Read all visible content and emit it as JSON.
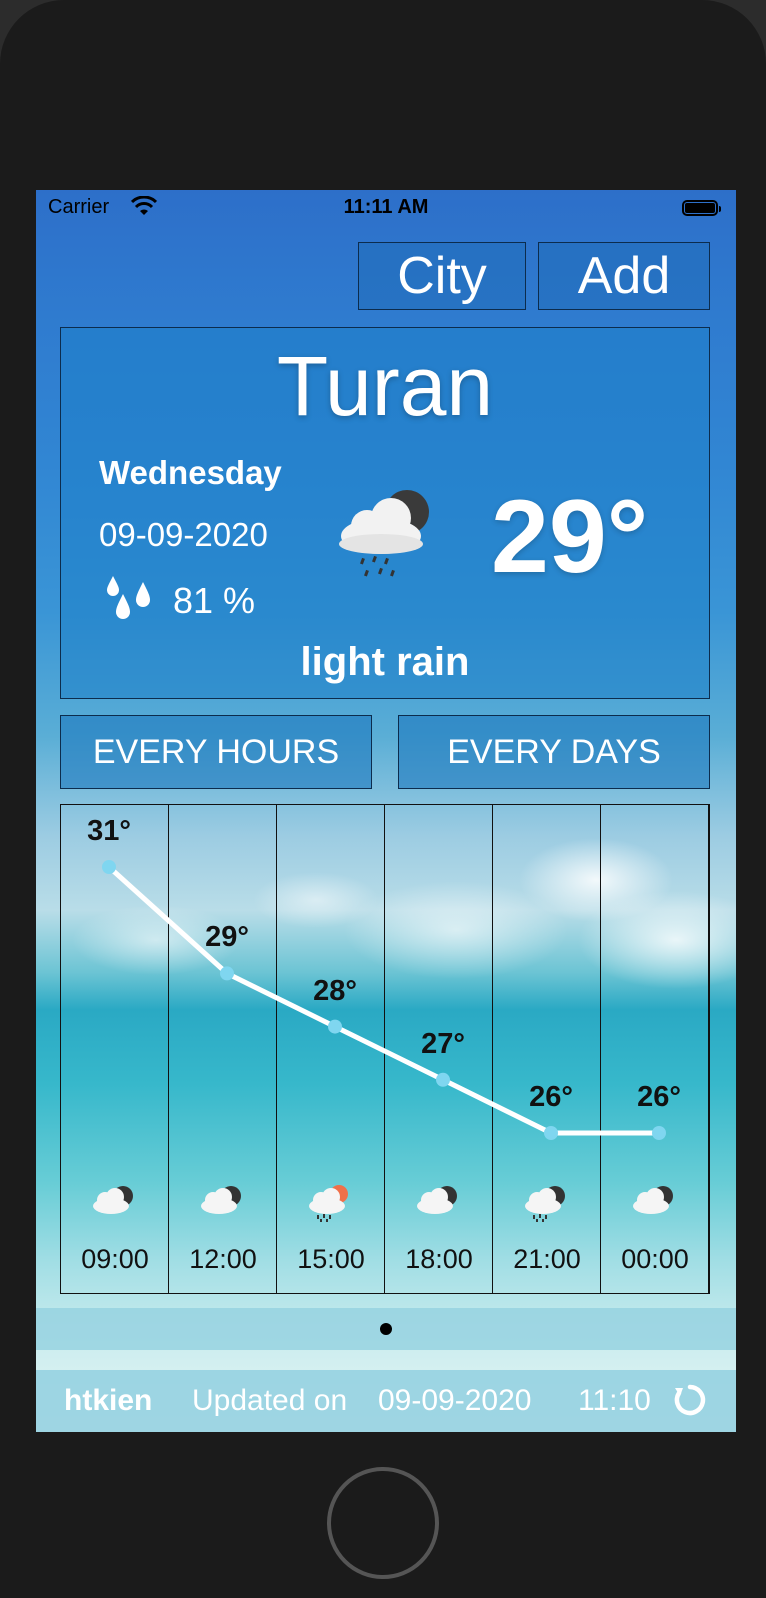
{
  "status_bar": {
    "carrier": "Carrier",
    "time": "11:11 AM"
  },
  "top_buttons": {
    "city": "City",
    "add": "Add"
  },
  "current": {
    "city": "Turan",
    "day": "Wednesday",
    "date": "09-09-2020",
    "humidity": "81 %",
    "temperature": "29°",
    "description": "light rain",
    "icon": "cloud-rain-night-icon"
  },
  "tabs": {
    "hours": "EVERY HOURS",
    "days": "EVERY DAYS"
  },
  "hourly": [
    {
      "time": "09:00",
      "temp_label": "31°",
      "temp": 31,
      "icon": "cloud-night-icon"
    },
    {
      "time": "12:00",
      "temp_label": "29°",
      "temp": 29,
      "icon": "cloud-night-icon"
    },
    {
      "time": "15:00",
      "temp_label": "28°",
      "temp": 28,
      "icon": "cloud-rain-sun-icon"
    },
    {
      "time": "18:00",
      "temp_label": "27°",
      "temp": 27,
      "icon": "cloud-night-icon"
    },
    {
      "time": "21:00",
      "temp_label": "26°",
      "temp": 26,
      "icon": "cloud-rain-night-icon"
    },
    {
      "time": "00:00",
      "temp_label": "26°",
      "temp": 26,
      "icon": "cloud-night-icon"
    }
  ],
  "footer": {
    "user": "htkien",
    "updated_label": "Updated on",
    "date": "09-09-2020",
    "time": "11:10"
  },
  "colors": {
    "line": "#ffffff",
    "point": "#7fd6f0",
    "panel_border": "#0c2c4d"
  }
}
